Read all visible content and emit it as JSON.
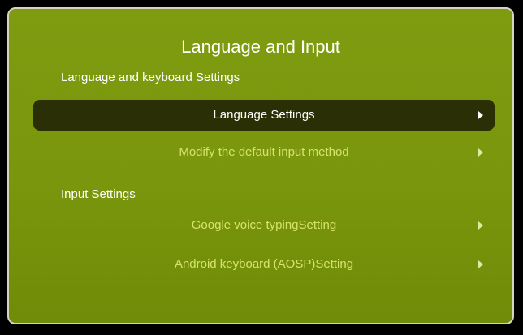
{
  "window": {
    "title": "Language and Input"
  },
  "sections": [
    {
      "header": "Language and keyboard Settings",
      "items": [
        {
          "label": "Language Settings",
          "selected": true,
          "icon": "chevron-right-icon"
        },
        {
          "label": "Modify the default input method",
          "selected": false,
          "icon": "chevron-right-icon"
        }
      ]
    },
    {
      "header": "Input Settings",
      "items": [
        {
          "label": "Google voice typingSetting",
          "selected": false,
          "icon": "chevron-right-icon"
        },
        {
          "label": "Android keyboard (AOSP)Setting",
          "selected": false,
          "icon": "chevron-right-icon"
        }
      ]
    }
  ],
  "colors": {
    "panel_background": "#7a960d",
    "selected_row": "#2a2f05",
    "item_text": "#d7e36b",
    "selected_text": "#ffffff"
  }
}
